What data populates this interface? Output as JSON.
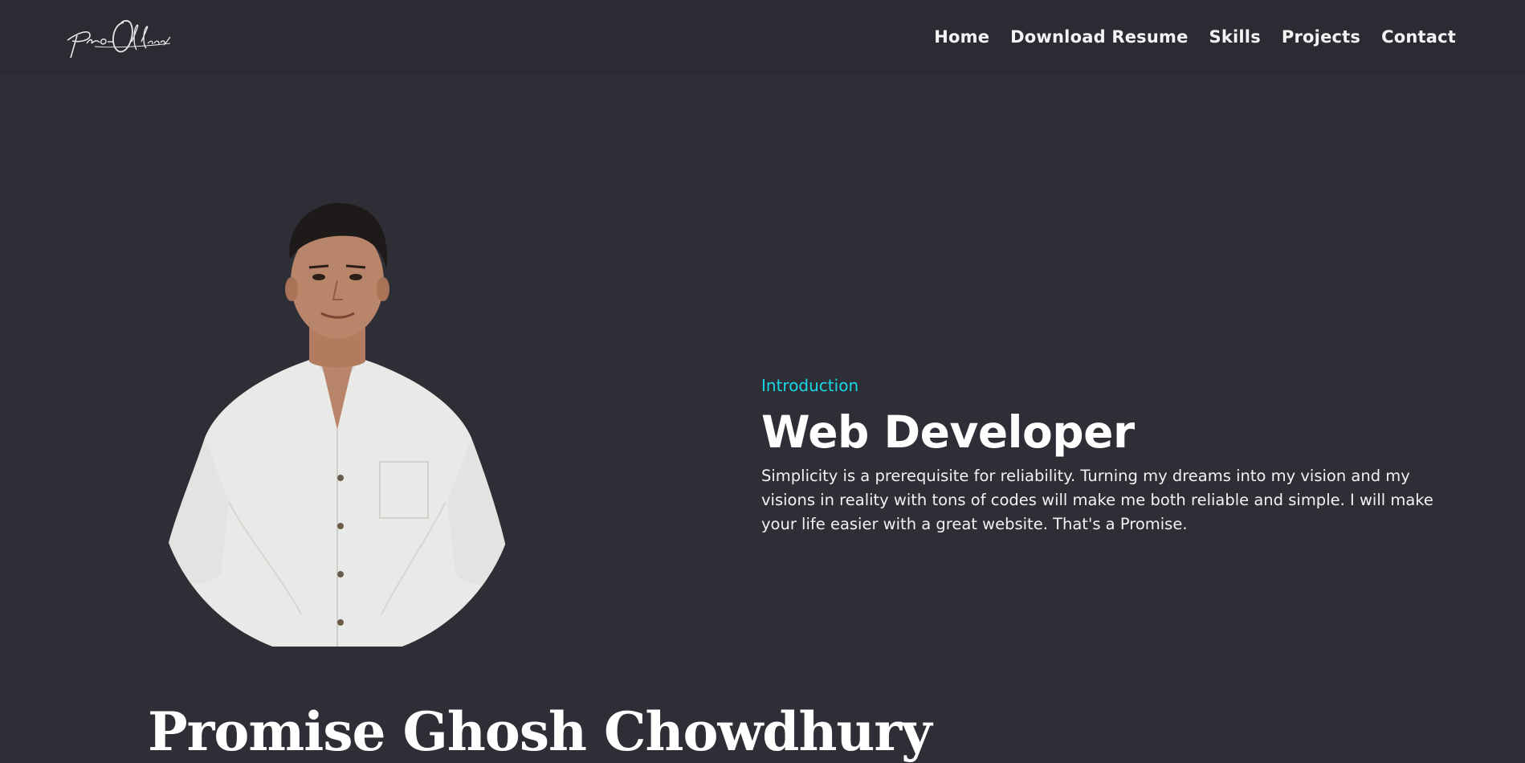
{
  "header": {
    "logo_text": "Pro-Official",
    "nav": [
      {
        "label": "Home"
      },
      {
        "label": "Download Resume"
      },
      {
        "label": "Skills"
      },
      {
        "label": "Projects"
      },
      {
        "label": "Contact"
      }
    ]
  },
  "hero": {
    "name": "Promise Ghosh Chowdhury",
    "intro_label": "Introduction",
    "title": "Web Developer",
    "description": "Simplicity is a prerequisite for reliability. Turning my dreams into my vision and my visions in reality with tons of codes will make me both reliable and simple. I will make your life easier with a great website. That's a Promise."
  },
  "colors": {
    "background": "#2e2f36",
    "navbar": "#2b2c33",
    "accent": "#19d8e6",
    "text": "#ffffff"
  }
}
